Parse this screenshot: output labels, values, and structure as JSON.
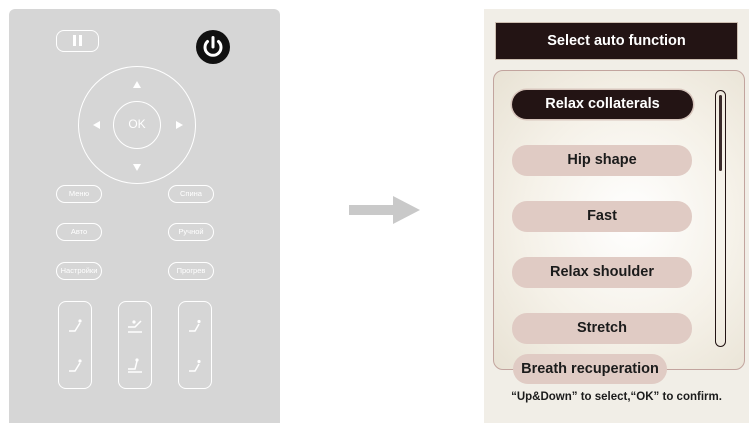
{
  "remote": {
    "ok_label": "OK",
    "buttons": [
      "Меню",
      "Спина",
      "Авто",
      "Ручной",
      "Настройки",
      "Прогрев"
    ]
  },
  "screen": {
    "header_title": "Select auto function",
    "items": [
      "Relax collaterals",
      "Hip shape",
      "Fast",
      "Relax shoulder",
      "Stretch",
      "Breath recuperation"
    ],
    "selected_index": 0,
    "hint": "“Up&Down” to select,“OK” to confirm."
  },
  "colors": {
    "remote_bg": "#d6d6d6",
    "screen_bg": "#f1eee7",
    "dark_accent": "#231414",
    "item_bg": "#e0cbc4"
  },
  "icons": [
    "pause-icon",
    "power-icon",
    "arrow-right-icon",
    "massage-chair-icon"
  ]
}
